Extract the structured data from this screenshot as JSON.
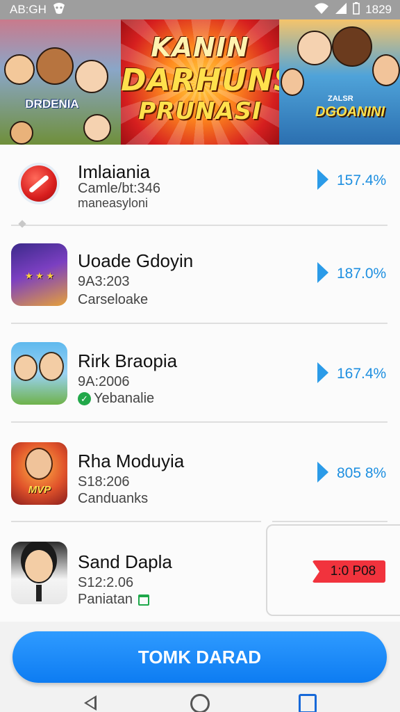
{
  "status_bar": {
    "left_text": "AB:GH",
    "time": "1829"
  },
  "banner": {
    "panel1_label": "DRDENIA",
    "panel2_line1": "KANIN",
    "panel2_line2": "DARHUNS",
    "panel2_line3": "PRUNASI",
    "panel3_small": "ZALSR",
    "panel3_label": "DGOANINI"
  },
  "apps": [
    {
      "title": "Imlaiania",
      "sub1": "Camle/bt:346",
      "sub2": "maneasyloni",
      "percent": "157.4%"
    },
    {
      "title": "Uoade Gdoyin",
      "sub1": "9A3:203",
      "sub2": "Carseloake",
      "percent": "187.0%"
    },
    {
      "title": "Rirk Braopia",
      "sub1": "9A:2006",
      "sub2": "Yebanalie",
      "percent": "167.4%"
    },
    {
      "title": "Rha Moduyia",
      "sub1": "S18:206",
      "sub2": "Canduanks",
      "percent": "805 8%"
    },
    {
      "title": "Sand Dapla",
      "sub1": "S12:2.06",
      "sub2": "Paniatan",
      "tag": "1:0 P08"
    }
  ],
  "cta": {
    "label": "TOMK DARAD"
  },
  "colors": {
    "accent": "#1e8fe0",
    "cta": "#0d7cf2",
    "tag": "#f1333d"
  }
}
